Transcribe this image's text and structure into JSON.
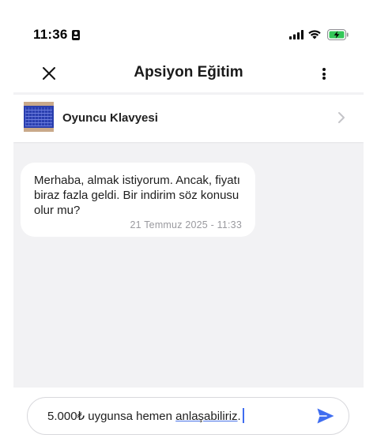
{
  "status_bar": {
    "time": "11:36",
    "icons": [
      "id-card-icon",
      "cellular-signal-icon",
      "wifi-icon",
      "battery-charging-icon"
    ]
  },
  "header": {
    "title": "Apsiyon Eğitim",
    "close_icon": "close-icon",
    "more_icon": "more-vertical-icon"
  },
  "product": {
    "name": "Oyuncu Klavyesi",
    "thumbnail": "keyboard-product-image",
    "chevron_icon": "chevron-right-icon"
  },
  "messages": [
    {
      "text": "Merhaba, almak istiyorum. Ancak, fiyatı biraz fazla geldi. Bir indirim söz konusu olur mu?",
      "timestamp": "21 Temmuz 2025 - 11:33"
    }
  ],
  "composer": {
    "value_plain": "5.000₺ uygunsa hemen ",
    "value_underlined": "anlaşabiliriz",
    "value_end": ".",
    "send_icon": "send-icon"
  },
  "colors": {
    "accent": "#3f6df0",
    "background": "#f2f2f4",
    "battery": "#34c759"
  }
}
